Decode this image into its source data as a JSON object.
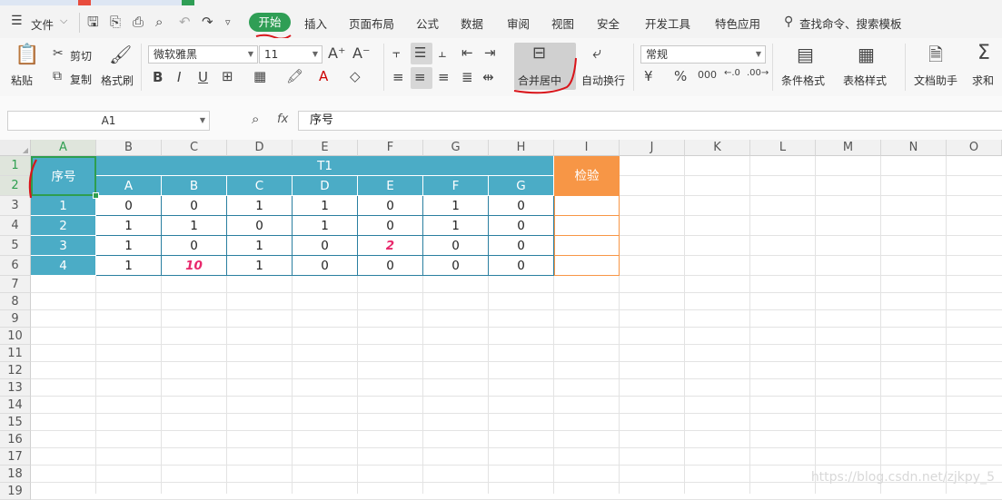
{
  "menubar": {
    "file_label": "文件",
    "tabs": [
      "开始",
      "插入",
      "页面布局",
      "公式",
      "数据",
      "审阅",
      "视图",
      "安全",
      "开发工具",
      "特色应用"
    ],
    "search_label": "查找命令、搜索模板"
  },
  "ribbon": {
    "paste": "粘贴",
    "cut": "剪切",
    "copy": "复制",
    "format_painter": "格式刷",
    "font_name": "微软雅黑",
    "font_size": "11",
    "merge_center": "合并居中",
    "wrap_text": "自动换行",
    "number_format": "常规",
    "conditional_format": "条件格式",
    "table_style": "表格样式",
    "doc_helper": "文档助手",
    "sum": "求和"
  },
  "formula_bar": {
    "cell_ref": "A1",
    "fx": "fx",
    "content": "序号"
  },
  "columns": [
    "A",
    "B",
    "C",
    "D",
    "E",
    "F",
    "G",
    "H",
    "I",
    "J",
    "K",
    "L",
    "M",
    "N",
    "O"
  ],
  "rows": [
    "1",
    "2",
    "3",
    "4",
    "5",
    "6",
    "7",
    "8",
    "9",
    "10",
    "11",
    "12",
    "13",
    "14",
    "15",
    "16",
    "17",
    "18",
    "19"
  ],
  "table": {
    "seq_header": "序号",
    "title": "T1",
    "check_header": "检验",
    "sub_headers": [
      "A",
      "B",
      "C",
      "D",
      "E",
      "F",
      "G"
    ],
    "seq": [
      "1",
      "2",
      "3",
      "4"
    ],
    "values": [
      [
        "0",
        "0",
        "1",
        "1",
        "0",
        "1",
        "0"
      ],
      [
        "1",
        "1",
        "0",
        "1",
        "0",
        "1",
        "0"
      ],
      [
        "1",
        "0",
        "1",
        "0",
        "2",
        "0",
        "0"
      ],
      [
        "1",
        "10",
        "1",
        "0",
        "0",
        "0",
        "0"
      ]
    ]
  },
  "colors": {
    "teal": "#4bacc6",
    "orange": "#f79646",
    "active_tab": "#2f9e55",
    "highlight": "#e8286b",
    "annotation": "#d9141a"
  },
  "watermark": "https://blog.csdn.net/zjkpy_5"
}
